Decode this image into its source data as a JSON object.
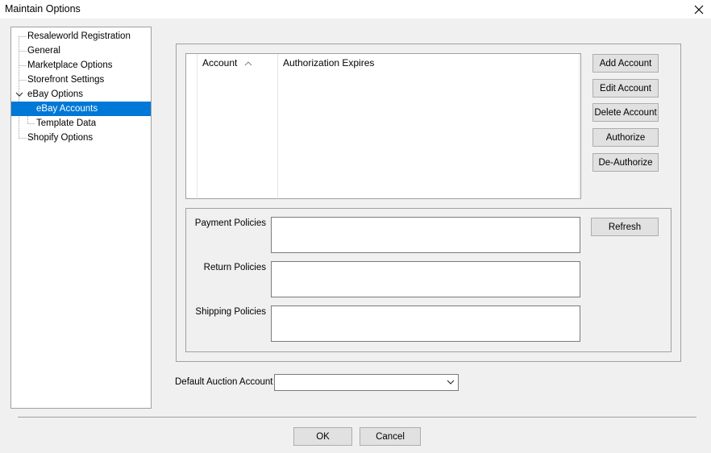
{
  "window": {
    "title": "Maintain Options"
  },
  "tree": {
    "items": [
      {
        "label": "Resaleworld Registration"
      },
      {
        "label": "General"
      },
      {
        "label": "Marketplace Options"
      },
      {
        "label": "Storefront Settings"
      },
      {
        "label": "eBay Options"
      },
      {
        "label": "eBay Accounts"
      },
      {
        "label": "Template Data"
      },
      {
        "label": "Shopify Options"
      }
    ],
    "selected": "eBay Accounts"
  },
  "accounts_list": {
    "columns": [
      "Account",
      "Authorization Expires"
    ],
    "sort_column": "Account",
    "sort_direction": "ascending",
    "rows": []
  },
  "account_buttons": {
    "add": "Add Account",
    "edit": "Edit Account",
    "delete": "Delete Account",
    "authorize": "Authorize",
    "deauthorize": "De-Authorize"
  },
  "policies": {
    "payment_label": "Payment Policies",
    "return_label": "Return Policies",
    "shipping_label": "Shipping Policies",
    "refresh_label": "Refresh"
  },
  "default_auction": {
    "label": "Default Auction Account",
    "value": ""
  },
  "footer": {
    "ok_label": "OK",
    "cancel_label": "Cancel"
  },
  "icons": {
    "close": "close-icon",
    "expand": "chevron-down-icon",
    "sort": "sort-ascending-icon",
    "dropdown": "chevron-down-icon"
  },
  "colors": {
    "selection": "#0078d7",
    "background": "#f0f0f0",
    "button": "#e1e1e1",
    "border": "#a0a0a0"
  }
}
